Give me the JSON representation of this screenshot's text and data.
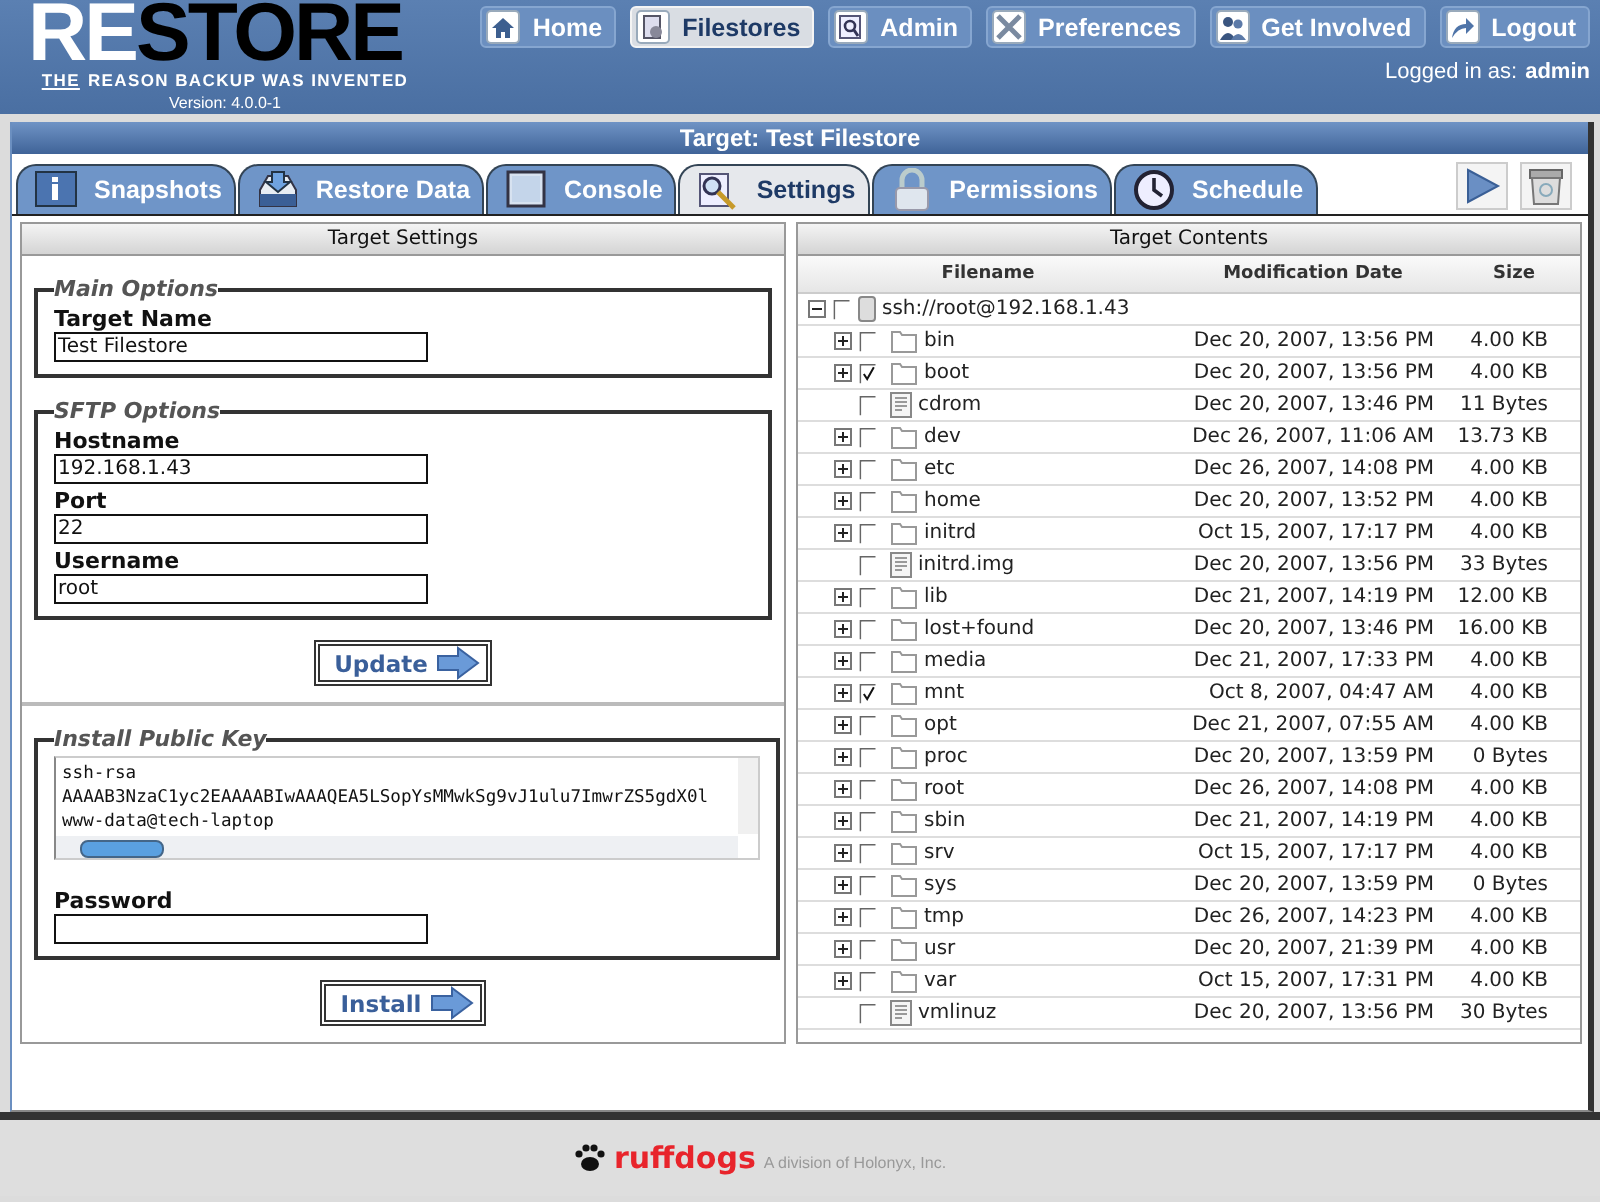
{
  "header": {
    "logo_light": "RE",
    "logo_dark": "STORE",
    "tagline_lead": "THE",
    "tagline": "REASON BACKUP WAS INVENTED",
    "version": "Version: 4.0.0-1",
    "nav": [
      {
        "label": "Home",
        "selected": false
      },
      {
        "label": "Filestores",
        "selected": true
      },
      {
        "label": "Admin",
        "selected": false
      },
      {
        "label": "Preferences",
        "selected": false
      },
      {
        "label": "Get Involved",
        "selected": false
      },
      {
        "label": "Logout",
        "selected": false
      }
    ],
    "login_label": "Logged in as:",
    "login_user": "admin"
  },
  "panel": {
    "title": "Target: Test Filestore",
    "tabs": [
      {
        "label": "Snapshots",
        "selected": false
      },
      {
        "label": "Restore Data",
        "selected": false
      },
      {
        "label": "Console",
        "selected": false
      },
      {
        "label": "Settings",
        "selected": true
      },
      {
        "label": "Permissions",
        "selected": false
      },
      {
        "label": "Schedule",
        "selected": false
      }
    ]
  },
  "settings": {
    "title": "Target Settings",
    "main_options": {
      "legend": "Main Options",
      "fields": [
        {
          "label": "Target Name",
          "value": "Test Filestore"
        }
      ]
    },
    "sftp_options": {
      "legend": "SFTP Options",
      "fields": [
        {
          "label": "Hostname",
          "value": "192.168.1.43"
        },
        {
          "label": "Port",
          "value": "22"
        },
        {
          "label": "Username",
          "value": "root"
        }
      ]
    },
    "update_button": "Update",
    "public_key": {
      "legend": "Install Public Key",
      "key": "ssh-rsa\nAAAAB3NzaC1yc2EAAAABIwAAAQEA5LSopYsMMwkSg9vJ1ulu7ImwrZS5gdX0l\nwww-data@tech-laptop",
      "password_label": "Password"
    },
    "install_button": "Install"
  },
  "contents": {
    "title": "Target Contents",
    "columns": [
      "Filename",
      "Modification Date",
      "Size"
    ],
    "root": {
      "name": "ssh://root@192.168.1.43",
      "checked": false,
      "expanded": true,
      "children": [
        {
          "kind": "folder",
          "name": "bin",
          "checked": false,
          "expanded": false,
          "date": "Dec 20, 2007, 13:56 PM",
          "size": "4.00 KB"
        },
        {
          "kind": "folder",
          "name": "boot",
          "checked": true,
          "expanded": false,
          "date": "Dec 20, 2007, 13:56 PM",
          "size": "4.00 KB"
        },
        {
          "kind": "file",
          "name": "cdrom",
          "checked": false,
          "date": "Dec 20, 2007, 13:46 PM",
          "size": "11 Bytes"
        },
        {
          "kind": "folder",
          "name": "dev",
          "checked": false,
          "expanded": false,
          "date": "Dec 26, 2007, 11:06 AM",
          "size": "13.73 KB"
        },
        {
          "kind": "folder",
          "name": "etc",
          "checked": false,
          "expanded": false,
          "date": "Dec 26, 2007, 14:08 PM",
          "size": "4.00 KB"
        },
        {
          "kind": "folder",
          "name": "home",
          "checked": false,
          "expanded": false,
          "date": "Dec 20, 2007, 13:52 PM",
          "size": "4.00 KB"
        },
        {
          "kind": "folder",
          "name": "initrd",
          "checked": false,
          "expanded": false,
          "date": "Oct 15, 2007, 17:17 PM",
          "size": "4.00 KB"
        },
        {
          "kind": "file",
          "name": "initrd.img",
          "checked": false,
          "date": "Dec 20, 2007, 13:56 PM",
          "size": "33 Bytes"
        },
        {
          "kind": "folder",
          "name": "lib",
          "checked": false,
          "expanded": false,
          "date": "Dec 21, 2007, 14:19 PM",
          "size": "12.00 KB"
        },
        {
          "kind": "folder",
          "name": "lost+found",
          "checked": false,
          "expanded": false,
          "date": "Dec 20, 2007, 13:46 PM",
          "size": "16.00 KB"
        },
        {
          "kind": "folder",
          "name": "media",
          "checked": false,
          "expanded": false,
          "date": "Dec 21, 2007, 17:33 PM",
          "size": "4.00 KB"
        },
        {
          "kind": "folder",
          "name": "mnt",
          "checked": true,
          "expanded": false,
          "date": "Oct 8, 2007, 04:47 AM",
          "size": "4.00 KB"
        },
        {
          "kind": "folder",
          "name": "opt",
          "checked": false,
          "expanded": false,
          "date": "Dec 21, 2007, 07:55 AM",
          "size": "4.00 KB"
        },
        {
          "kind": "folder",
          "name": "proc",
          "checked": false,
          "expanded": false,
          "date": "Dec 20, 2007, 13:59 PM",
          "size": "0 Bytes"
        },
        {
          "kind": "folder",
          "name": "root",
          "checked": false,
          "expanded": false,
          "date": "Dec 26, 2007, 14:08 PM",
          "size": "4.00 KB"
        },
        {
          "kind": "folder",
          "name": "sbin",
          "checked": false,
          "expanded": false,
          "date": "Dec 21, 2007, 14:19 PM",
          "size": "4.00 KB"
        },
        {
          "kind": "folder",
          "name": "srv",
          "checked": false,
          "expanded": false,
          "date": "Oct 15, 2007, 17:17 PM",
          "size": "4.00 KB"
        },
        {
          "kind": "folder",
          "name": "sys",
          "checked": false,
          "expanded": false,
          "date": "Dec 20, 2007, 13:59 PM",
          "size": "0 Bytes"
        },
        {
          "kind": "folder",
          "name": "tmp",
          "checked": false,
          "expanded": false,
          "date": "Dec 26, 2007, 14:23 PM",
          "size": "4.00 KB"
        },
        {
          "kind": "folder",
          "name": "usr",
          "checked": false,
          "expanded": false,
          "date": "Dec 20, 2007, 21:39 PM",
          "size": "4.00 KB"
        },
        {
          "kind": "folder",
          "name": "var",
          "checked": false,
          "expanded": false,
          "date": "Oct 15, 2007, 17:31 PM",
          "size": "4.00 KB"
        },
        {
          "kind": "file",
          "name": "vmlinuz",
          "checked": false,
          "date": "Dec 20, 2007, 13:56 PM",
          "size": "30 Bytes"
        }
      ]
    }
  },
  "footer": {
    "brand": "ruffdogs",
    "tagline": "A division of Holonyx, Inc."
  }
}
